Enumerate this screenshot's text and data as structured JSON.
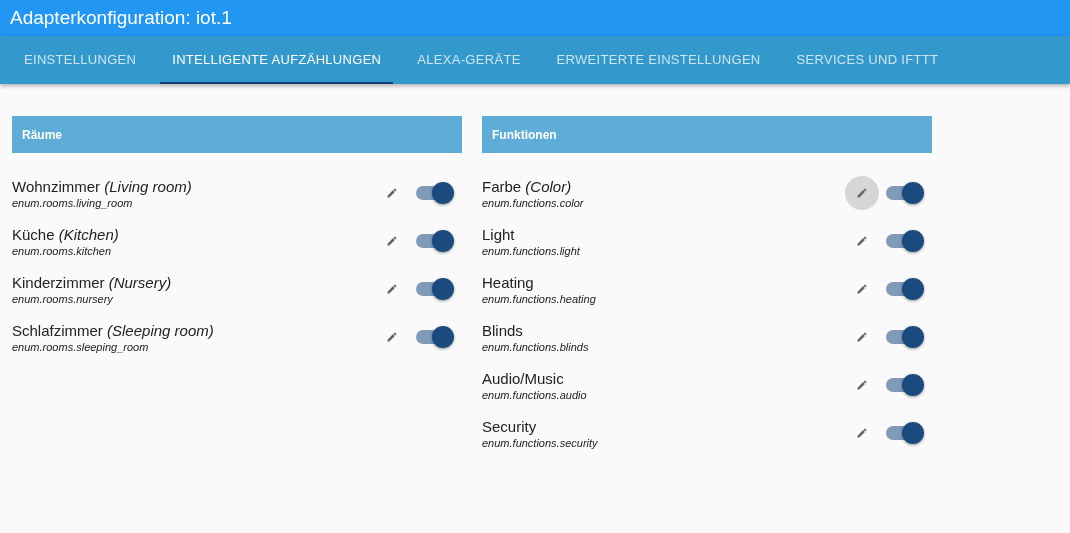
{
  "window": {
    "title": "Adapterkonfiguration: iot.1"
  },
  "tabs": [
    {
      "label": "EINSTELLUNGEN",
      "selected": false
    },
    {
      "label": "INTELLIGENTE AUFZÄHLUNGEN",
      "selected": true
    },
    {
      "label": "ALEXA-GERÄTE",
      "selected": false
    },
    {
      "label": "ERWEITERTE EINSTELLUNGEN",
      "selected": false
    },
    {
      "label": "SERVICES UND IFTTT",
      "selected": false
    }
  ],
  "panels": [
    {
      "title": "Räume",
      "items": [
        {
          "name": "Wohnzimmer *(Living room)*",
          "id": "enum.rooms.living_room",
          "on": true,
          "highlighted": false
        },
        {
          "name": "Küche *(Kitchen)*",
          "id": "enum.rooms.kitchen",
          "on": true,
          "highlighted": false
        },
        {
          "name": "Kinderzimmer *(Nursery)*",
          "id": "enum.rooms.nursery",
          "on": true,
          "highlighted": false
        },
        {
          "name": "Schlafzimmer *(Sleeping room)*",
          "id": "enum.rooms.sleeping_room",
          "on": true,
          "highlighted": false
        }
      ]
    },
    {
      "title": "Funktionen",
      "items": [
        {
          "name": "Farbe *(Color)*",
          "id": "enum.functions.color",
          "on": true,
          "highlighted": true
        },
        {
          "name": "Light",
          "id": "enum.functions.light",
          "on": true,
          "highlighted": false
        },
        {
          "name": "Heating",
          "id": "enum.functions.heating",
          "on": true,
          "highlighted": false
        },
        {
          "name": "Blinds",
          "id": "enum.functions.blinds",
          "on": true,
          "highlighted": false
        },
        {
          "name": "Audio/Music",
          "id": "enum.functions.audio",
          "on": true,
          "highlighted": false
        },
        {
          "name": "Security",
          "id": "enum.functions.security",
          "on": true,
          "highlighted": false
        }
      ]
    }
  ]
}
